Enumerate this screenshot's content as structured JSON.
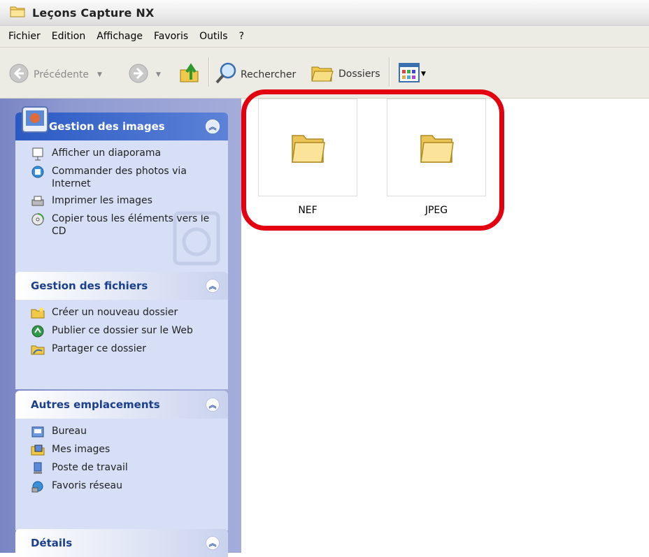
{
  "window": {
    "title": "Leçons Capture NX"
  },
  "menu": [
    "Fichier",
    "Edition",
    "Affichage",
    "Favoris",
    "Outils",
    "?"
  ],
  "toolbar": {
    "back_label": "Précédente",
    "search_label": "Rechercher",
    "folders_label": "Dossiers"
  },
  "panels": {
    "images": {
      "title": "Gestion des images",
      "items": [
        "Afficher un diaporama",
        "Commander des photos via Internet",
        "Imprimer les images",
        "Copier tous les éléments vers le CD"
      ]
    },
    "files": {
      "title": "Gestion des fichiers",
      "items": [
        "Créer un nouveau dossier",
        "Publier ce dossier sur le Web",
        "Partager ce dossier"
      ]
    },
    "places": {
      "title": "Autres emplacements",
      "items": [
        "Bureau",
        "Mes images",
        "Poste de travail",
        "Favoris réseau"
      ]
    },
    "details": {
      "title": "Détails"
    }
  },
  "folders": [
    {
      "name": "NEF"
    },
    {
      "name": "JPEG"
    }
  ],
  "colors": {
    "highlight": "#e3000f",
    "panel_title": "#215dc6"
  }
}
